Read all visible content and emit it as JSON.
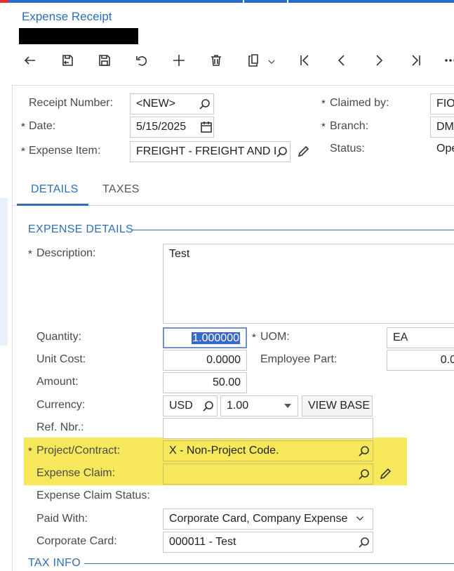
{
  "header": {
    "title": "Expense Receipt"
  },
  "toolbar": {
    "buttons": [
      "back-icon",
      "save-close-icon",
      "save-icon",
      "undo-icon",
      "add-icon",
      "delete-icon",
      "copy-paste-icon",
      "chevron-down-icon",
      "first-icon",
      "previous-icon",
      "next-icon",
      "last-icon",
      "more-icon"
    ]
  },
  "summary": {
    "receipt_number_label": "Receipt Number:",
    "receipt_number_value": "<NEW>",
    "date_label": "Date:",
    "date_value": "5/15/2025",
    "expense_item_label": "Expense Item:",
    "expense_item_value": "FREIGHT - FREIGHT AND I",
    "claimed_by_label": "Claimed by:",
    "claimed_by_value": "FIO",
    "branch_label": "Branch:",
    "branch_value": "DM",
    "status_label": "Status:",
    "status_value": "Ope",
    "required_mark": "*"
  },
  "tabs": [
    {
      "label": "DETAILS",
      "active": true
    },
    {
      "label": "TAXES",
      "active": false
    }
  ],
  "details": {
    "section_title": "EXPENSE DETAILS",
    "description_label": "Description:",
    "description_value": "Test",
    "quantity_label": "Quantity:",
    "quantity_value": "1.000000",
    "uom_label": "UOM:",
    "uom_value": "EA",
    "unit_cost_label": "Unit Cost:",
    "unit_cost_value": "0.0000",
    "employee_part_label": "Employee Part:",
    "employee_part_value": "0.0",
    "amount_label": "Amount:",
    "amount_value": "50.00",
    "currency_label": "Currency:",
    "currency_value": "USD",
    "currency_rate": "1.00",
    "view_base_label": "VIEW BASE",
    "ref_nbr_label": "Ref. Nbr.:",
    "ref_nbr_value": "",
    "project_label": "Project/Contract:",
    "project_value": "X - Non-Project Code.",
    "expense_claim_label": "Expense Claim:",
    "expense_claim_value": "",
    "expense_claim_status_label": "Expense Claim Status:",
    "paid_with_label": "Paid With:",
    "paid_with_value": "Corporate Card, Company Expense",
    "corporate_card_label": "Corporate Card:",
    "corporate_card_value": "000011 - Test"
  },
  "tax_section_title": "TAX INFO",
  "colors": {
    "accent": "#2f6fb5",
    "highlight": "#f6e85a",
    "selection": "#3868c8"
  }
}
